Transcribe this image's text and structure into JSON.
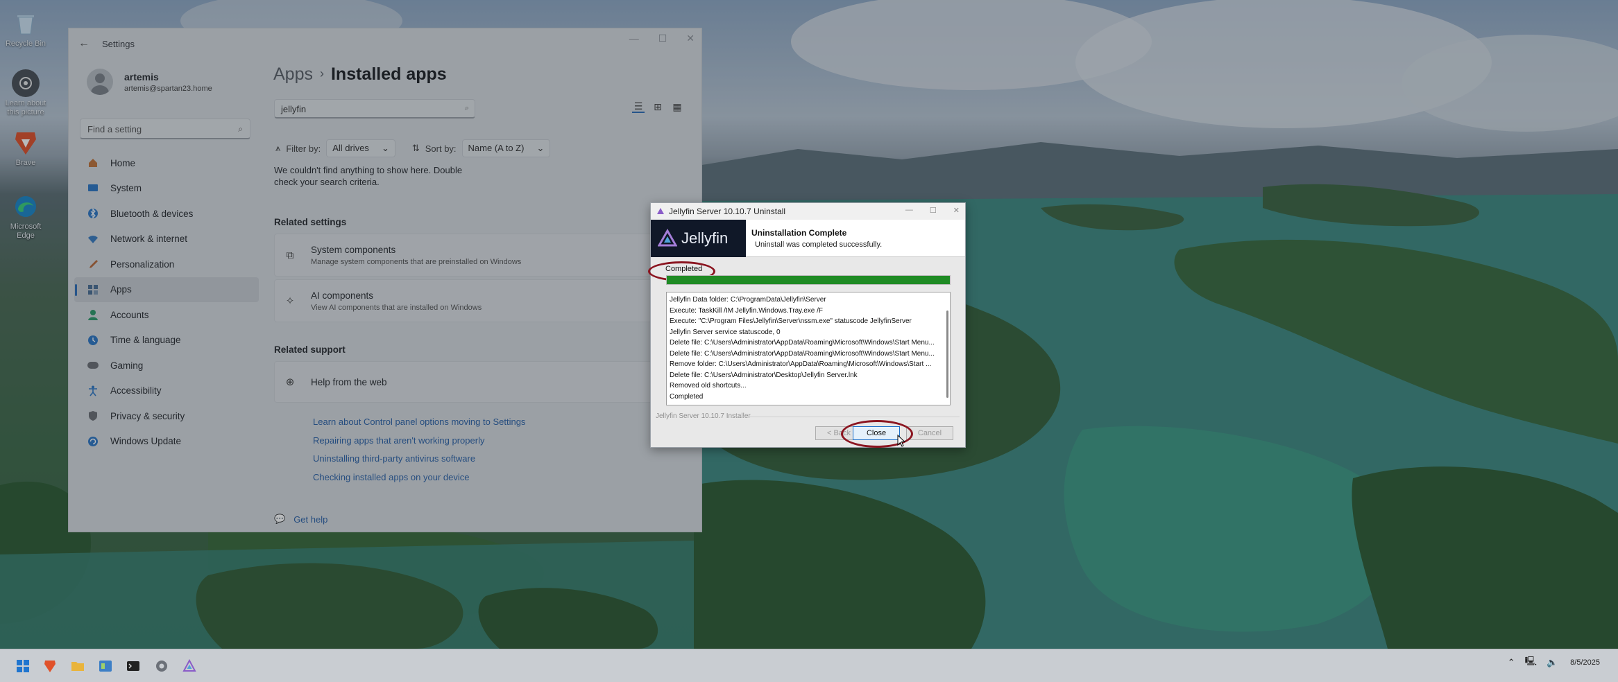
{
  "desktop": {
    "icons": [
      {
        "label": "Recycle Bin",
        "icon": "recycle-bin-icon"
      },
      {
        "label": "Learn about this picture",
        "icon": "camera-icon"
      },
      {
        "label": "Brave",
        "icon": "brave-icon"
      },
      {
        "label": "Microsoft Edge",
        "icon": "edge-icon"
      }
    ]
  },
  "settings": {
    "window_title": "Settings",
    "user": {
      "name": "artemis",
      "email": "artemis@spartan23.home"
    },
    "find_placeholder": "Find a setting",
    "nav": [
      {
        "label": "Home",
        "icon": "home-icon",
        "color": "#c1733a"
      },
      {
        "label": "System",
        "icon": "monitor-icon",
        "color": "#2f78c4"
      },
      {
        "label": "Bluetooth & devices",
        "icon": "bluetooth-icon",
        "color": "#2f78c4"
      },
      {
        "label": "Network & internet",
        "icon": "wifi-icon",
        "color": "#3a7cc1"
      },
      {
        "label": "Personalization",
        "icon": "brush-icon",
        "color": "#b86a3b"
      },
      {
        "label": "Apps",
        "icon": "apps-icon",
        "color": "#4b6f94"
      },
      {
        "label": "Accounts",
        "icon": "account-icon",
        "color": "#2e9a6a"
      },
      {
        "label": "Time & language",
        "icon": "globe-clock-icon",
        "color": "#2f78c4"
      },
      {
        "label": "Gaming",
        "icon": "gamepad-icon",
        "color": "#6c6f74"
      },
      {
        "label": "Accessibility",
        "icon": "accessibility-icon",
        "color": "#2f78c4"
      },
      {
        "label": "Privacy & security",
        "icon": "shield-icon",
        "color": "#6c6f74"
      },
      {
        "label": "Windows Update",
        "icon": "update-icon",
        "color": "#2f78c4"
      }
    ],
    "breadcrumb": {
      "parent": "Apps",
      "current": "Installed apps"
    },
    "search_value": "jellyfin",
    "filter": {
      "filter_label": "Filter by:",
      "filter_value": "All drives",
      "sort_label": "Sort by:",
      "sort_value": "Name (A to Z)"
    },
    "empty_message": "We couldn't find anything to show here. Double check your search criteria.",
    "related_settings_heading": "Related settings",
    "related_settings": [
      {
        "title": "System components",
        "subtitle": "Manage system components that are preinstalled on Windows"
      },
      {
        "title": "AI components",
        "subtitle": "View AI components that are installed on Windows"
      }
    ],
    "related_support_heading": "Related support",
    "help_from_web": "Help from the web",
    "support_links": [
      "Learn about Control panel options moving to Settings",
      "Repairing apps that aren't working properly",
      "Uninstalling third-party antivirus software",
      "Checking installed apps on your device"
    ],
    "get_help": "Get help"
  },
  "uninstaller": {
    "window_title": "Jellyfin Server 10.10.7 Uninstall",
    "brand": "Jellyfin",
    "header_title": "Uninstallation Complete",
    "header_subtitle": "Uninstall was completed successfully.",
    "status": "Completed",
    "progress": 1.0,
    "progress_color": "#1f8b24",
    "log": [
      "Jellyfin Data folder: C:\\ProgramData\\Jellyfin\\Server",
      "Execute: TaskKill /IM Jellyfin.Windows.Tray.exe /F",
      "Execute: \"C:\\Program Files\\Jellyfin\\Server\\nssm.exe\" statuscode JellyfinServer",
      "Jellyfin Server service statuscode, 0",
      "Delete file: C:\\Users\\Administrator\\AppData\\Roaming\\Microsoft\\Windows\\Start Menu...",
      "Delete file: C:\\Users\\Administrator\\AppData\\Roaming\\Microsoft\\Windows\\Start Menu...",
      "Remove folder: C:\\Users\\Administrator\\AppData\\Roaming\\Microsoft\\Windows\\Start ...",
      "Delete file: C:\\Users\\Administrator\\Desktop\\Jellyfin Server.lnk",
      "Removed old shortcuts...",
      "Completed"
    ],
    "branding_line": "Jellyfin Server 10.10.7 Installer",
    "buttons": {
      "back": "< Back",
      "close": "Close",
      "cancel": "Cancel"
    },
    "highlight_color": "#8b1520"
  },
  "taskbar": {
    "apps": [
      "start-icon",
      "brave-icon",
      "file-explorer-icon",
      "control-panel-icon",
      "terminal-icon",
      "settings-icon",
      "jellyfin-icon"
    ],
    "clock": {
      "time": "",
      "date": "8/5/2025"
    }
  }
}
